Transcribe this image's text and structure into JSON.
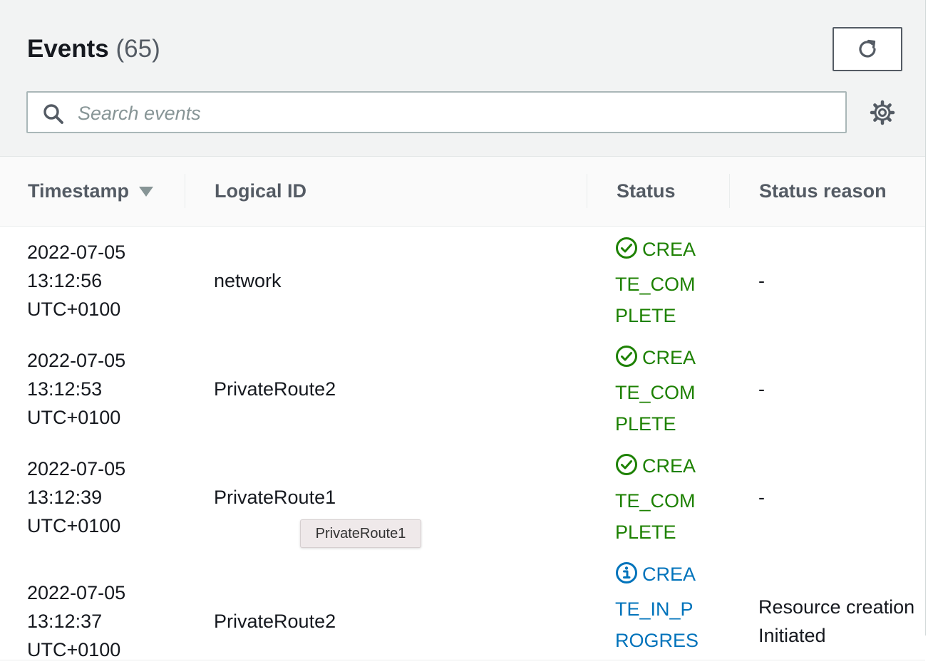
{
  "header": {
    "title": "Events",
    "count": "(65)"
  },
  "search": {
    "placeholder": "Search events",
    "value": ""
  },
  "icons": {
    "refresh": "refresh-icon",
    "search": "search-icon",
    "settings": "gear-icon",
    "sort": "sort-descending-icon",
    "success": "check-circle-icon",
    "info": "info-circle-icon"
  },
  "columns": {
    "timestamp": "Timestamp",
    "logical_id": "Logical ID",
    "status": "Status",
    "status_reason": "Status reason"
  },
  "colors": {
    "success": "#1d8102",
    "info": "#0073bb"
  },
  "rows": [
    {
      "date": "2022-07-05",
      "time": "13:12:56",
      "tz": "UTC+0100",
      "logical_id": "network",
      "status_lines": [
        "CREA",
        "TE_COM",
        "PLETE"
      ],
      "status_type": "success",
      "status_reason": "-"
    },
    {
      "date": "2022-07-05",
      "time": "13:12:53",
      "tz": "UTC+0100",
      "logical_id": "PrivateRoute2",
      "status_lines": [
        "CREA",
        "TE_COM",
        "PLETE"
      ],
      "status_type": "success",
      "status_reason": "-"
    },
    {
      "date": "2022-07-05",
      "time": "13:12:39",
      "tz": "UTC+0100",
      "logical_id": "PrivateRoute1",
      "status_lines": [
        "CREA",
        "TE_COM",
        "PLETE"
      ],
      "status_type": "success",
      "status_reason": "-"
    },
    {
      "date": "2022-07-05",
      "time": "13:12:37",
      "tz": "UTC+0100",
      "logical_id": "PrivateRoute2",
      "status_lines": [
        "CREA",
        "TE_IN_P",
        "ROGRES"
      ],
      "status_type": "info",
      "status_reason_lines": [
        "Resource creation",
        "Initiated"
      ]
    }
  ],
  "tooltip": {
    "text": "PrivateRoute1"
  }
}
